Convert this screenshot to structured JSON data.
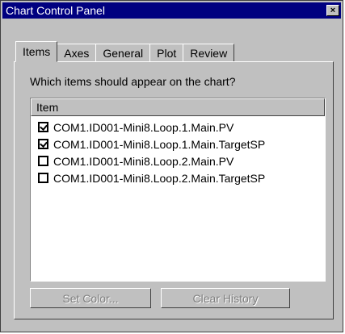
{
  "window": {
    "title": "Chart Control Panel",
    "close_glyph": "×"
  },
  "tabs": [
    {
      "label": "Items",
      "active": true
    },
    {
      "label": "Axes",
      "active": false
    },
    {
      "label": "General",
      "active": false
    },
    {
      "label": "Plot",
      "active": false
    },
    {
      "label": "Review",
      "active": false
    }
  ],
  "prompt": "Which items should appear on the chart?",
  "list": {
    "header": "Item",
    "items": [
      {
        "label": "COM1.ID001-Mini8.Loop.1.Main.PV",
        "checked": true
      },
      {
        "label": "COM1.ID001-Mini8.Loop.1.Main.TargetSP",
        "checked": true
      },
      {
        "label": "COM1.ID001-Mini8.Loop.2.Main.PV",
        "checked": false
      },
      {
        "label": "COM1.ID001-Mini8.Loop.2.Main.TargetSP",
        "checked": false
      }
    ]
  },
  "buttons": {
    "set_color": {
      "label": "Set Color...",
      "enabled": false
    },
    "clear_history": {
      "label": "Clear History",
      "enabled": false
    }
  },
  "colors": {
    "titlebar": "#000080",
    "face": "#c0c0c0",
    "disabled_text": "#808080"
  }
}
